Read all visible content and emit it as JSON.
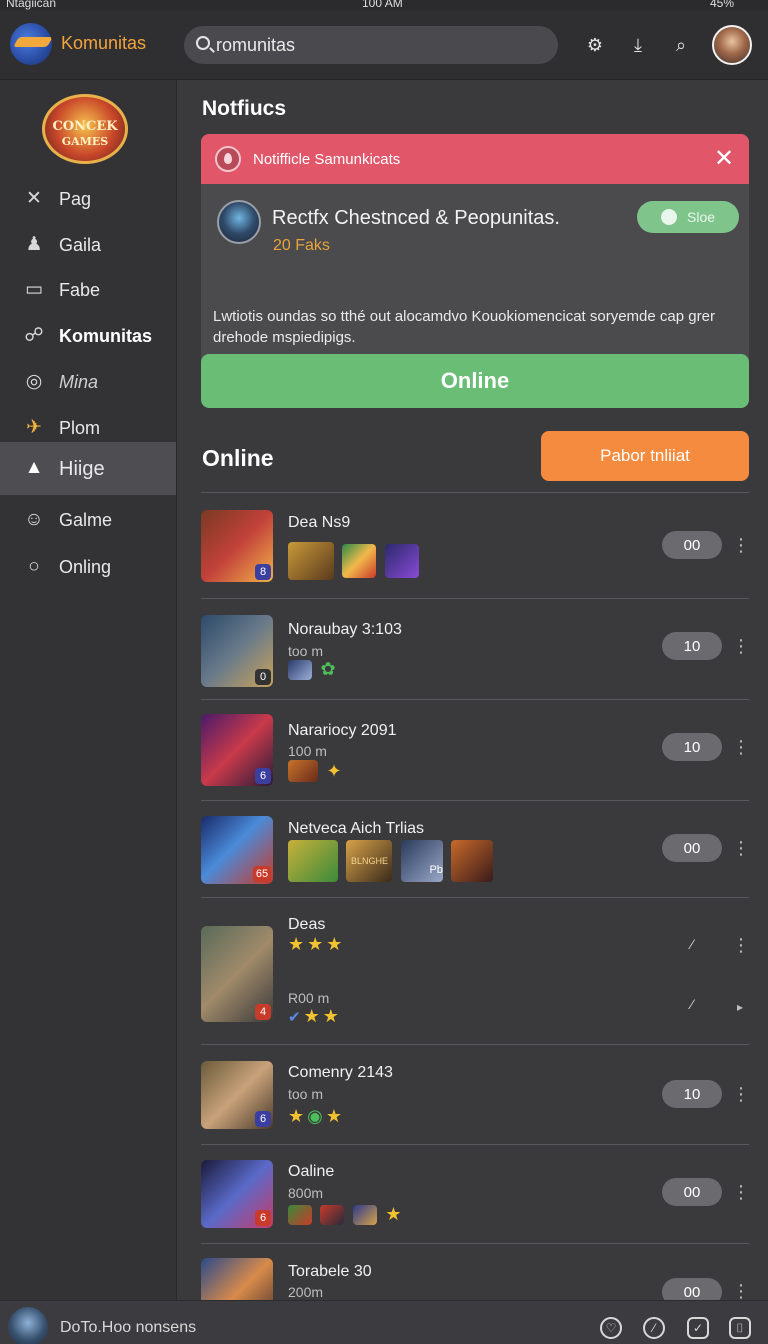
{
  "status": {
    "left": "Ntagiican",
    "time": "100 AM",
    "right": "45%"
  },
  "header": {
    "app_title": "Komunitas",
    "search_value": "romunitas",
    "icons": [
      "gear-icon",
      "download-icon",
      "search-icon",
      "avatar"
    ]
  },
  "sidebar": {
    "brand_line1": "CONCEK",
    "brand_line2": "GAMES",
    "items": [
      {
        "label": "Pag",
        "icon": "✕"
      },
      {
        "label": "Gaila",
        "icon": "♟"
      },
      {
        "label": "Fabe",
        "icon": "▭"
      },
      {
        "label": "Komunitas",
        "icon": "☍"
      },
      {
        "label": "Mina",
        "icon": "◎"
      },
      {
        "label": "Plom",
        "icon": "✈"
      },
      {
        "label": "Hiige",
        "icon": "▲"
      },
      {
        "label": "Galme",
        "icon": "☺"
      },
      {
        "label": "Onling",
        "icon": "○"
      }
    ]
  },
  "notifications": {
    "title": "Notfiucs",
    "header_text": "Notifficle Samunkicats",
    "name": "Rectfx Chestnced & Peopunitas.",
    "sub": "20 Faks",
    "tag": "Sloe",
    "body": "Lwtiotis oundas so tthé out alocamdvo Kouokiomencicat soryemde cap grer drehode mspiedipigs.",
    "cta": "Online"
  },
  "online": {
    "title": "Online",
    "button": "Pabor tnliiat",
    "rows": [
      {
        "title": "Dea Ns9",
        "sub": "",
        "badge": "8",
        "pill": "00"
      },
      {
        "title": "Noraubay 3:103",
        "sub": "too m",
        "badge": "0",
        "pill": "10"
      },
      {
        "title": "Narariocy 2091",
        "sub": "100 m",
        "badge": "6",
        "pill": "10"
      },
      {
        "title": "Netveca Aich Trlias",
        "sub": "",
        "badge": "65",
        "pill": "00"
      },
      {
        "title": "Deas",
        "sub": "R00 m",
        "badge": "4",
        "pill": ""
      },
      {
        "title": "Comenry 2143",
        "sub": "too m",
        "badge": "6",
        "pill": "10"
      },
      {
        "title": "Oaline",
        "sub": "800m",
        "badge": "6",
        "pill": "00"
      },
      {
        "title": "Torabele 30",
        "sub": "200m",
        "badge": "",
        "pill": "00"
      }
    ],
    "mini_labels": {
      "r4_a": "BLNGHE",
      "r4_b": "Pb"
    }
  },
  "footer": {
    "text": "DoTo.Hoo nonsens"
  },
  "colors": {
    "accent": "#f48b3e",
    "success": "#6abd74",
    "danger": "#e2566a",
    "brand": "#f3a43a"
  }
}
